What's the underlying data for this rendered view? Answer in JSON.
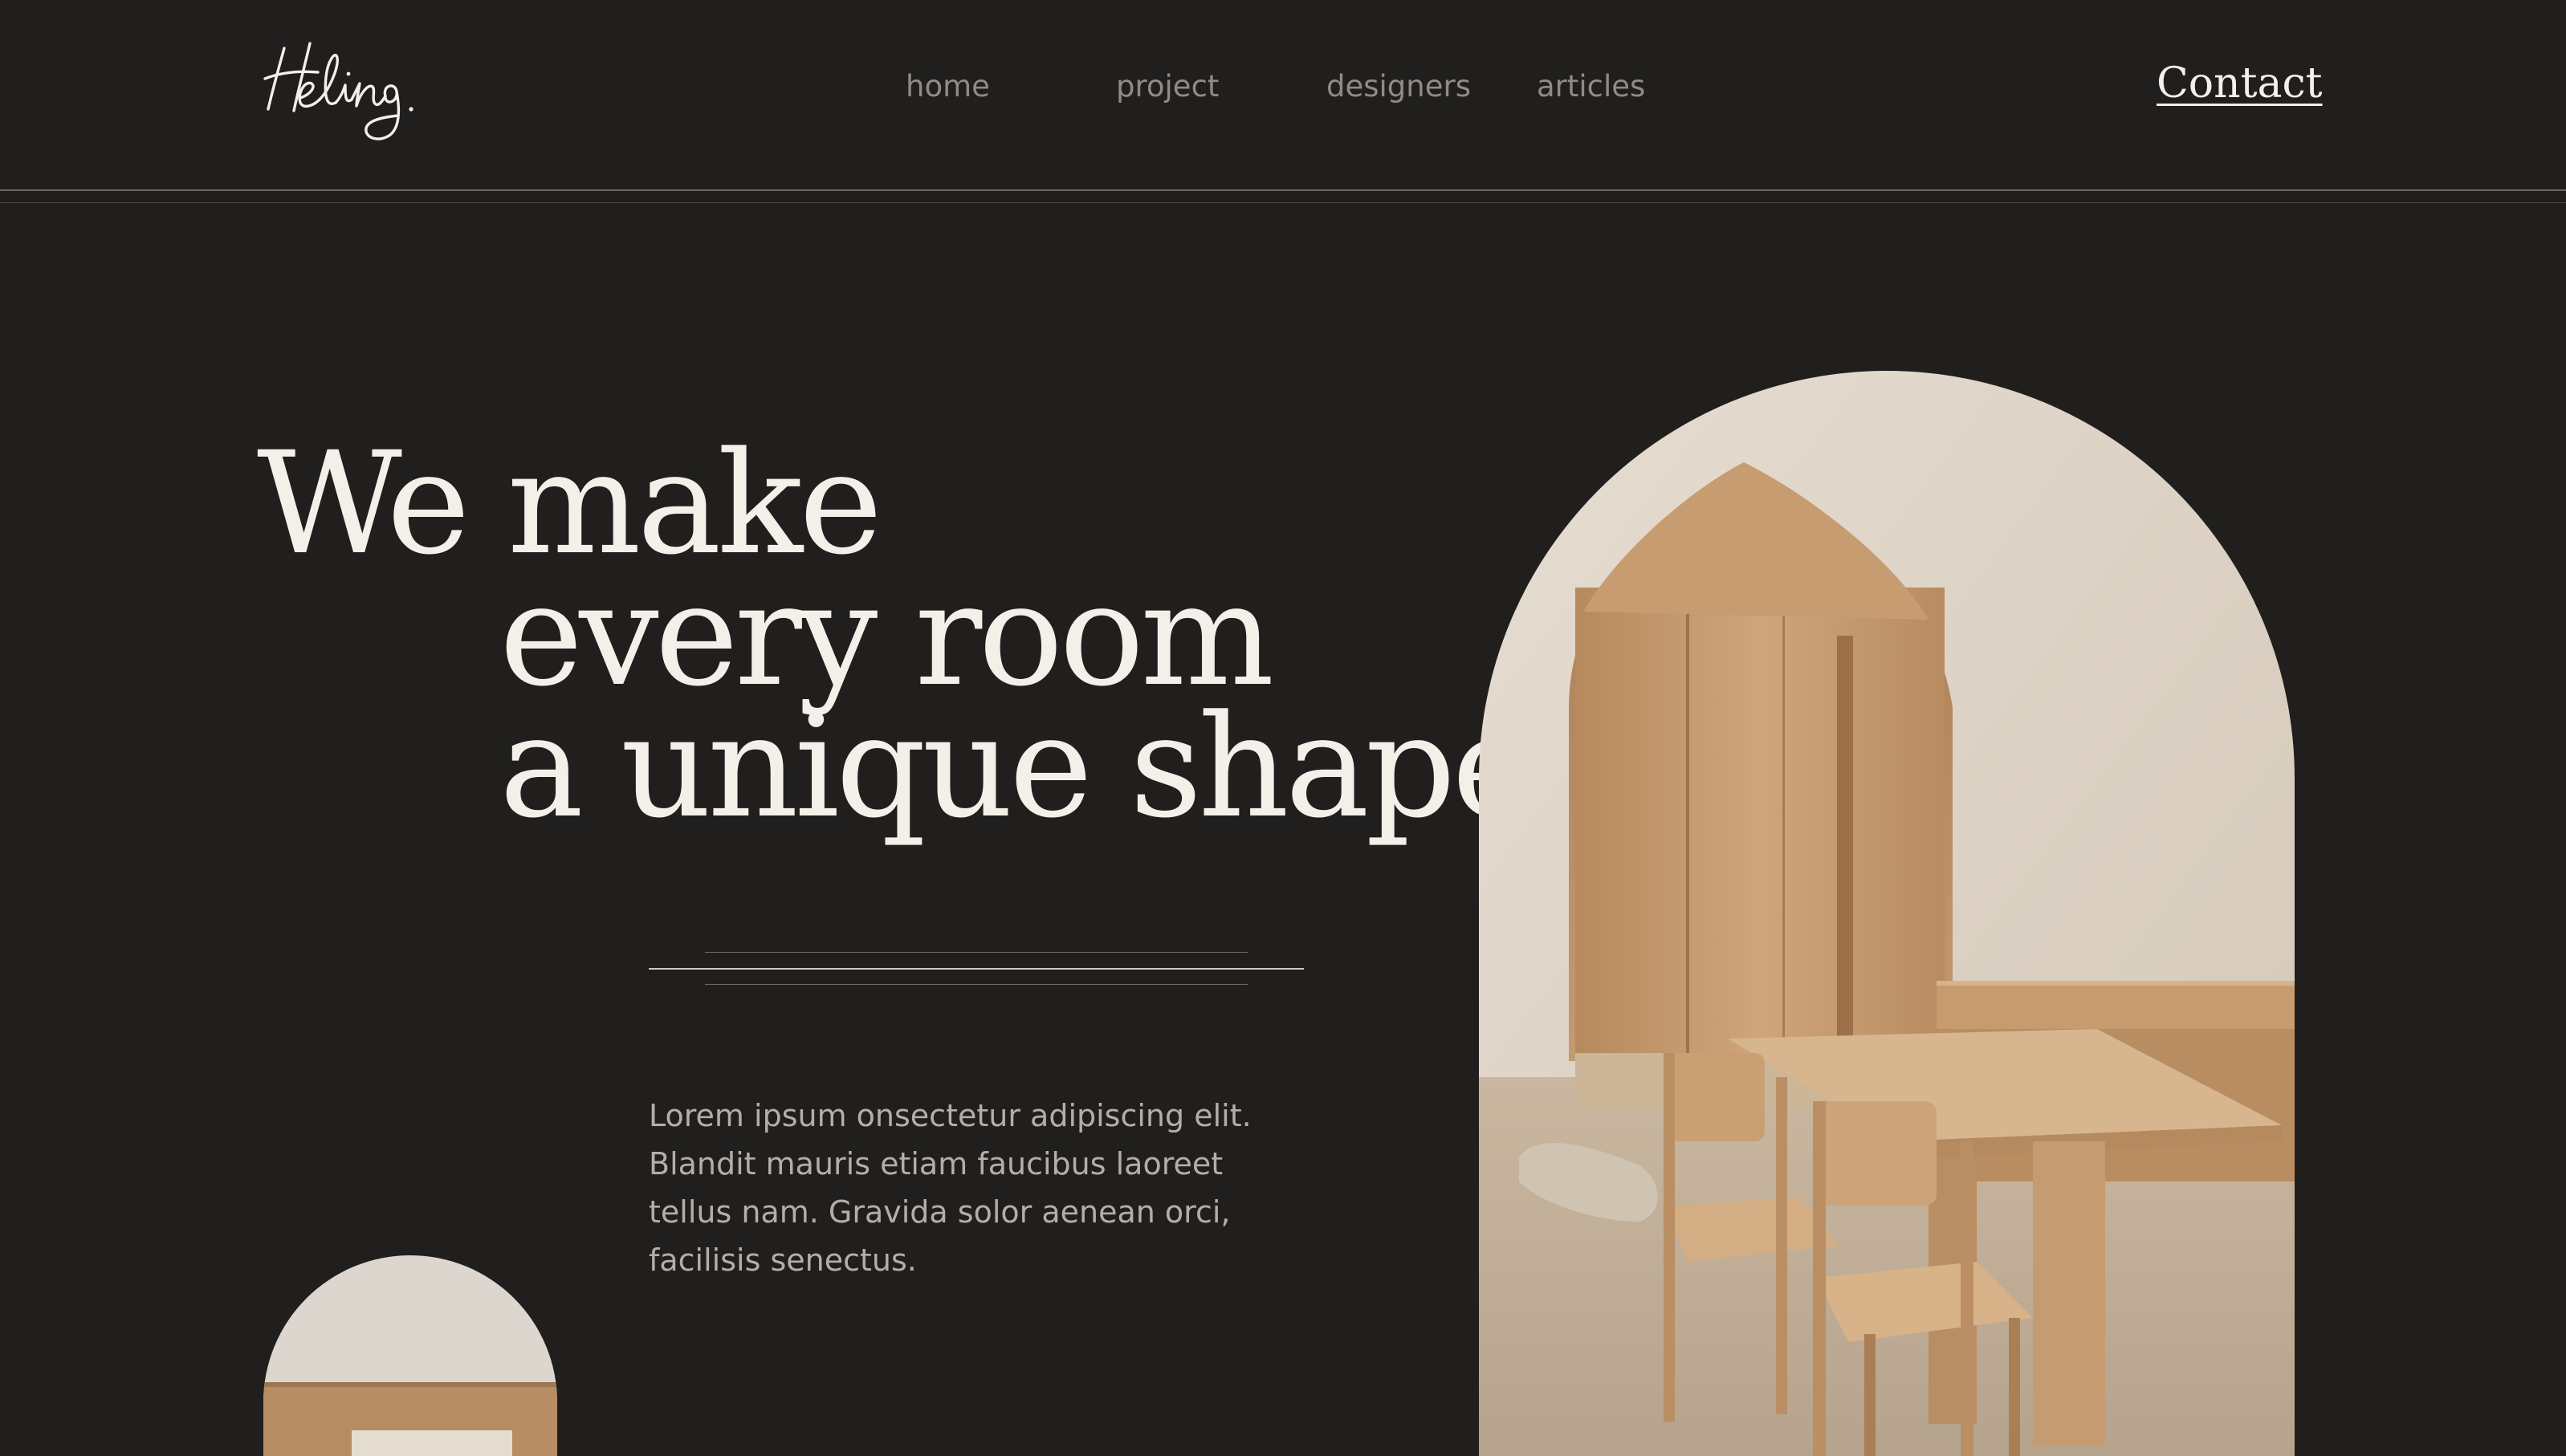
{
  "brand": {
    "logo_text": "Heling."
  },
  "nav": {
    "items": [
      {
        "label": "home"
      },
      {
        "label": "project"
      },
      {
        "label": "designers"
      },
      {
        "label": "articles"
      }
    ],
    "contact_label": "Contact"
  },
  "hero": {
    "heading_lines": [
      "We make",
      "every room",
      "a unique shape"
    ],
    "body": "Lorem ipsum onsectetur adipiscing elit. Blandit mauris etiam faucibus laoreet tellus nam. Gravida solor aenean orci, facilisis senectus."
  },
  "colors": {
    "background": "#201f1e",
    "heading": "#f4efe8",
    "nav": "#8f8b87",
    "body": "#b3aea8",
    "accent_wood": "#c9a27a"
  },
  "images": {
    "hero": "arched-interior-photo",
    "secondary": "arched-room-photo"
  }
}
